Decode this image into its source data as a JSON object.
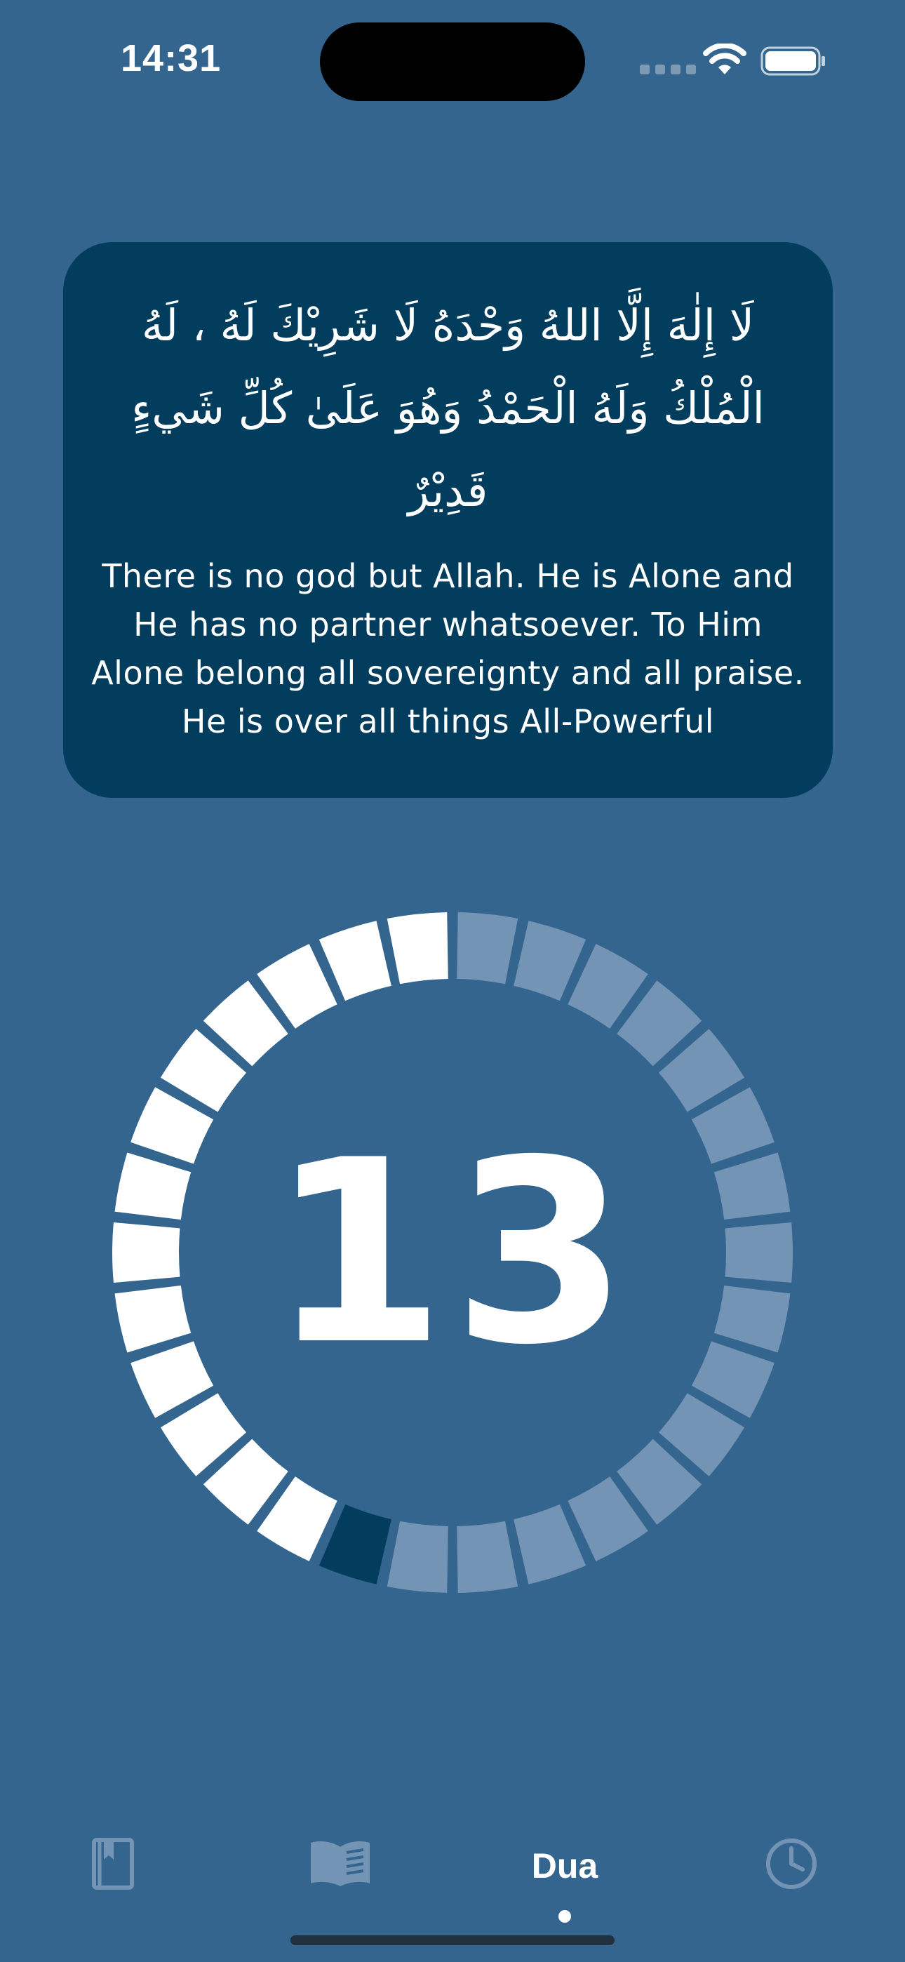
{
  "status_bar": {
    "time": "14:31"
  },
  "dua_card": {
    "arabic": "لَا إِلٰهَ إِلَّا اللهُ وَحْدَهُ لَا شَرِيْكَ لَهُ ، لَهُ الْمُلْكُ وَلَهُ الْحَمْدُ وَهُوَ عَلَىٰ كُلِّ شَيءٍ قَدِيْرٌ",
    "translation": "There is no god but Allah. He is Alone and He has no partner whatsoever. To Him Alone belong all sovereignty and all praise. He is over all things All-Powerful"
  },
  "counter": {
    "count": "13",
    "total_segments": 30,
    "completed_segments": 13,
    "colors": {
      "completed": "#ffffff",
      "current": "#023d5d",
      "remaining": "#7394b4"
    }
  },
  "tab_bar": {
    "tabs": [
      {
        "id": "bookmarks",
        "icon": "bookmark-book-icon"
      },
      {
        "id": "reader",
        "icon": "open-book-icon"
      },
      {
        "id": "dua",
        "label": "Dua",
        "active": true
      },
      {
        "id": "history",
        "icon": "clock-icon"
      }
    ]
  },
  "theme": {
    "background": "#33658f",
    "card": "#023d5d",
    "icon_muted": "#7394b4"
  }
}
